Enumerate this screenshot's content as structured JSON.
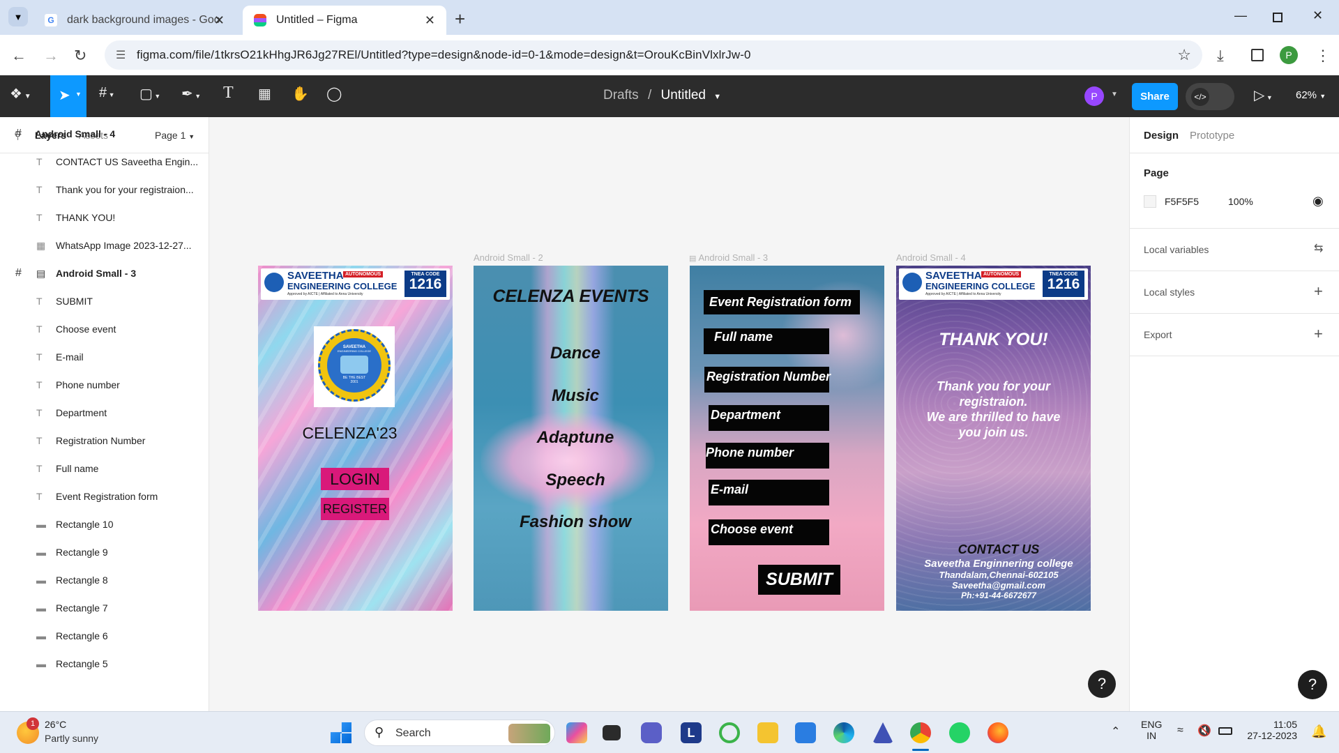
{
  "browser": {
    "tabs": [
      {
        "title": "dark background images - Goo",
        "active": false
      },
      {
        "title": "Untitled – Figma",
        "active": true
      }
    ],
    "url": "figma.com/file/1tkrsO21kHhgJR6Jg27REl/Untitled?type=design&node-id=0-1&mode=design&t=OrouKcBinVlxlrJw-0",
    "profile_initial": "P"
  },
  "figma": {
    "breadcrumb_folder": "Drafts",
    "separator": "/",
    "file_name": "Untitled",
    "share_label": "Share",
    "zoom": "62%",
    "user_initial": "P",
    "left_tabs": {
      "layers": "Layers",
      "assets": "Assets",
      "page": "Page 1"
    },
    "layers": [
      {
        "name": "Android Small - 4",
        "type": "frame",
        "indent": 0,
        "bold": true
      },
      {
        "name": "CONTACT US Saveetha Engin...",
        "type": "text",
        "indent": 1
      },
      {
        "name": "Thank you for your registraion...",
        "type": "text",
        "indent": 1
      },
      {
        "name": "THANK YOU!",
        "type": "text",
        "indent": 1
      },
      {
        "name": "WhatsApp Image 2023-12-27...",
        "type": "image",
        "indent": 1
      },
      {
        "name": "Android Small - 3",
        "type": "frame",
        "indent": 0,
        "bold": true
      },
      {
        "name": "SUBMIT",
        "type": "text",
        "indent": 1
      },
      {
        "name": "Choose event",
        "type": "text",
        "indent": 1
      },
      {
        "name": "E-mail",
        "type": "text",
        "indent": 1
      },
      {
        "name": "Phone number",
        "type": "text",
        "indent": 1
      },
      {
        "name": "Department",
        "type": "text",
        "indent": 1
      },
      {
        "name": "Registration Number",
        "type": "text",
        "indent": 1
      },
      {
        "name": "Full name",
        "type": "text",
        "indent": 1
      },
      {
        "name": "Event Registration form",
        "type": "text",
        "indent": 1
      },
      {
        "name": "Rectangle 10",
        "type": "rect",
        "indent": 1
      },
      {
        "name": "Rectangle 9",
        "type": "rect",
        "indent": 1
      },
      {
        "name": "Rectangle 8",
        "type": "rect",
        "indent": 1
      },
      {
        "name": "Rectangle 7",
        "type": "rect",
        "indent": 1
      },
      {
        "name": "Rectangle 6",
        "type": "rect",
        "indent": 1
      },
      {
        "name": "Rectangle 5",
        "type": "rect",
        "indent": 1
      }
    ],
    "frames": {
      "f1": {
        "label": "",
        "college": "SAVEETHA",
        "college2": "ENGINEERING COLLEGE",
        "autonomous": "AUTONOMOUS",
        "approved": "Approved by AICTE | Affiliated to Anna University",
        "tnea": "TNEA CODE",
        "code": "1216",
        "emblem_top": "SAVEETHA",
        "emblem_sub": "ENGINEERING COLLEGE",
        "emblem_motto": "BE THE BEST",
        "emblem_year": "2001",
        "title": "CELENZA'23",
        "login": "LOGIN",
        "register": "REGISTER"
      },
      "f2": {
        "label": "Android Small - 2",
        "title": "CELENZA EVENTS",
        "events": [
          "Dance",
          "Music",
          "Adaptune",
          "Speech",
          "Fashion show"
        ]
      },
      "f3": {
        "label": "Android Small - 3",
        "header": "Event Registration form",
        "fields": [
          "Full name",
          "Registration Number",
          "Department",
          "Phone number",
          "E-mail",
          "Choose event"
        ],
        "submit": "SUBMIT"
      },
      "f4": {
        "label": "Android Small - 4",
        "thanks": "THANK YOU!",
        "message": [
          "Thank you for your",
          "registraion.",
          "We are thrilled  to have",
          "you join us."
        ],
        "contact_title": "CONTACT US",
        "contact_lines": [
          "Saveetha Enginnering college",
          "Thandalam,Chennai-602105",
          "Saveetha@gmail.com",
          "Ph:+91-44-6672677"
        ]
      }
    },
    "right_tabs": {
      "design": "Design",
      "prototype": "Prototype"
    },
    "page_section": {
      "title": "Page",
      "color": "F5F5F5",
      "opacity": "100%"
    },
    "sections": [
      "Local variables",
      "Local styles",
      "Export"
    ]
  },
  "taskbar": {
    "weather_temp": "26°C",
    "weather_desc": "Partly sunny",
    "weather_badge": "1",
    "search_placeholder": "Search",
    "lang1": "ENG",
    "lang2": "IN",
    "time": "11:05",
    "date": "27-12-2023"
  },
  "colors": {
    "figma_blue": "#0d99ff",
    "toolbar": "#2c2c2c",
    "login_pink": "#d9197a"
  }
}
